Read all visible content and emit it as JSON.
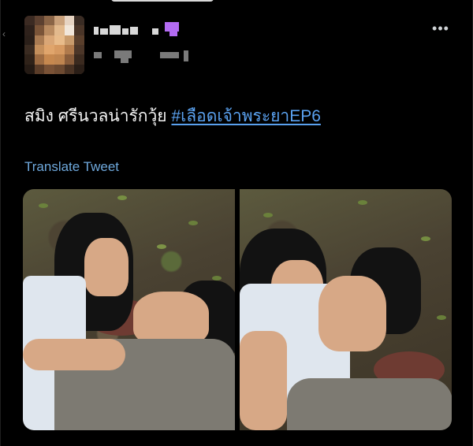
{
  "tweet": {
    "text": "สมิง ศรีนวลน่ารักวุ้ย ",
    "hashtag": "#เลือดเจ้าพระยาEP6",
    "translate_label": "Translate Tweet"
  },
  "header": {
    "more_icon": "more-horizontal-icon",
    "more_glyph": "•••"
  },
  "media": {
    "count": 2
  },
  "colors": {
    "background": "#000000",
    "link": "#5aa1ef",
    "translate": "#6ea8dc",
    "text": "#f3f3f3"
  }
}
